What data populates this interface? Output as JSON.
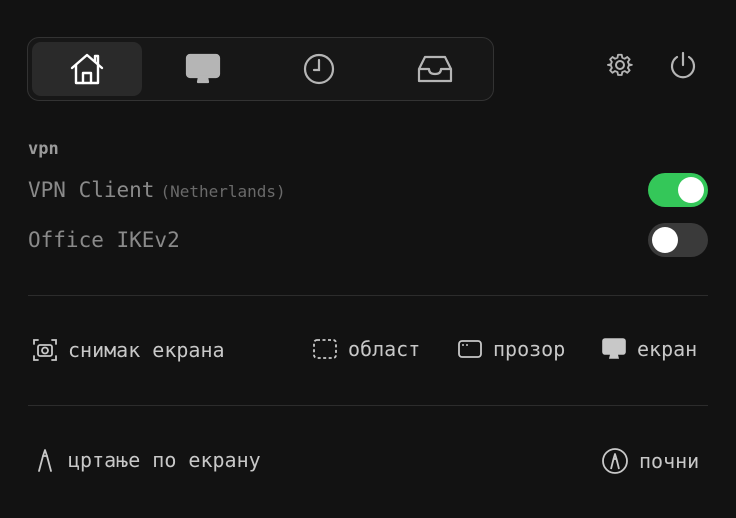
{
  "tabs": [
    {
      "icon": "home-icon",
      "active": true
    },
    {
      "icon": "monitor-icon",
      "active": false
    },
    {
      "icon": "clock-icon",
      "active": false
    },
    {
      "icon": "inbox-icon",
      "active": false
    }
  ],
  "header": {
    "settings_icon": "gear-icon",
    "power_icon": "power-icon"
  },
  "vpn": {
    "section_label": "vpn",
    "items": [
      {
        "name": "VPN Client",
        "country": "(Netherlands)",
        "enabled": true
      },
      {
        "name": "Office IKEv2",
        "country": "",
        "enabled": false
      }
    ]
  },
  "screenshot": {
    "label": "снимак екрана",
    "area_label": "област",
    "window_label": "прозор",
    "screen_label": "екран"
  },
  "draw": {
    "label": "цртање по екрану",
    "start_label": "почни"
  },
  "colors": {
    "background": "#121212",
    "toggle_on": "#34c759",
    "toggle_off": "#3a3a3a",
    "active_tab": "#2a2a2a"
  }
}
